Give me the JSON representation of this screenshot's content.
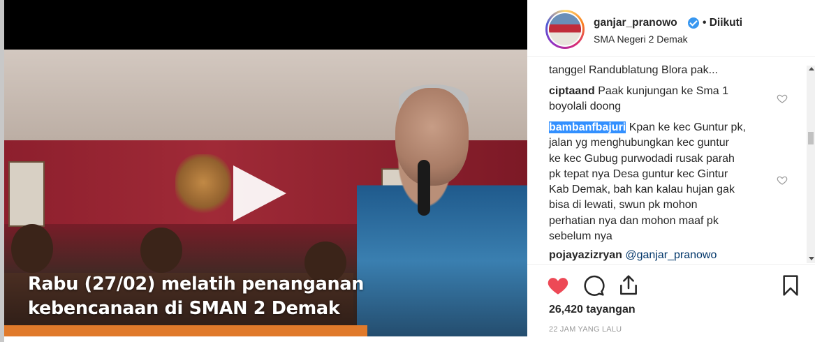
{
  "video": {
    "caption_line1": "Rabu (27/02) melatih penanganan",
    "caption_line2": "kebencanaan di SMAN 2 Demak"
  },
  "post": {
    "username": "ganjar_pranowo",
    "follow_label": "• Diikuti",
    "location": "SMA Negeri 2 Demak",
    "views": "26,420 tayangan",
    "time": "22 JAM YANG LALU"
  },
  "comments": [
    {
      "user": "",
      "text": "tanggel Randublatung Blora pak..."
    },
    {
      "user": "ciptaand",
      "text_line1": "Paak kunjungan ke Sma 1",
      "text_line2": "boyolali doong"
    },
    {
      "user": "bambanfbajuri",
      "lines": [
        "Kpan ke kec Guntur pk,",
        "jalan yg menghubungkan kec guntur",
        "ke kec Gubug purwodadi rusak parah",
        "pk tepat nya Desa guntur kec Gintur",
        "Kab Demak, bah kan kalau hujan gak",
        "bisa di lewati, swun pk mohon",
        "perhatian nya dan mohon maaf pk",
        "sebelum nya"
      ]
    },
    {
      "user": "pojayazizryan",
      "mention": "@ganjar_pranowo"
    }
  ],
  "icons": [
    "heart-icon-filled",
    "comment-icon",
    "share-icon",
    "bookmark-icon",
    "play-icon",
    "verified-icon"
  ],
  "colors": {
    "like": "#ed4956",
    "verified": "#3897f0",
    "selection": "#3390ff",
    "mention": "#003569"
  }
}
